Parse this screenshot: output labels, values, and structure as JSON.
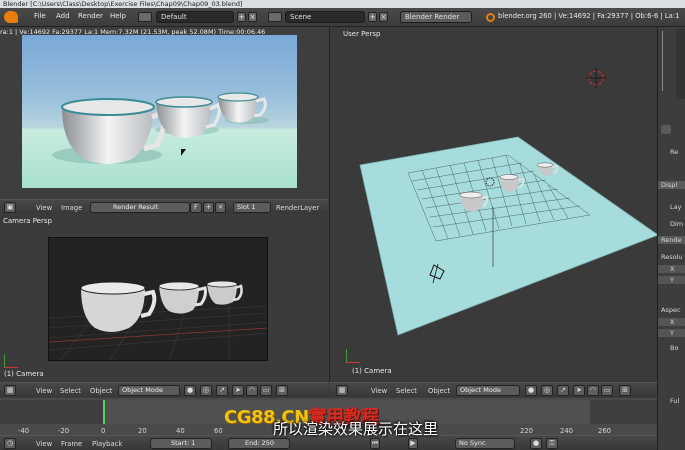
{
  "window": {
    "title": "Blender  [C:\\Users\\Class\\Desktop\\Exercise Files\\Chap09\\Chap09_03.blend]"
  },
  "info_header": {
    "menus": [
      "File",
      "Add",
      "Render",
      "Help"
    ],
    "screen_layout": "Default",
    "scene": "Scene",
    "engine": "Blender Render",
    "stats": "blender.org 260 | Ve:14692 | Fa:29377 | Ob:6-6 | La:1"
  },
  "image_editor": {
    "render_stats": "ra:1 | Ve:14692 Fa:29377 La:1 Mem:7.32M (21.53M, peak 52.08M) Time:00:06.46",
    "menus": [
      "View",
      "Image"
    ],
    "image_name": "Render Result",
    "fake_user": "F",
    "slot": "Slot 1",
    "layer": "RenderLayer"
  },
  "camera_view": {
    "label": "Camera Persp",
    "object": "(1) Camera"
  },
  "user_view": {
    "label": "User Persp",
    "object": "(1) Camera"
  },
  "view3d_header": {
    "menus": [
      "View",
      "Select",
      "Object"
    ],
    "mode": "Object Mode"
  },
  "timeline": {
    "ticks": [
      "-40",
      "-20",
      "0",
      "20",
      "40",
      "60",
      "80",
      "100",
      "120",
      "140",
      "160",
      "180",
      "200",
      "220",
      "240",
      "260"
    ],
    "menus": [
      "View",
      "Frame",
      "Playback"
    ],
    "start": "Start: 1",
    "end": "End: 250",
    "sync": "No Sync"
  },
  "properties": {
    "items": [
      "Re",
      "Displ",
      "Lay",
      "Dim",
      "Rende",
      "Resolu",
      "X",
      "Y",
      "Aspec",
      "X",
      "Y",
      "Bo",
      "Ful"
    ]
  },
  "overlay": {
    "watermark_a": "CG88.CN",
    "watermark_b": "實用教程",
    "subtitle": "所以渲染效果展示在这里"
  },
  "colors": {
    "accent": "#5680c2",
    "floor": "#a6dcdc",
    "render_bg": "#87b3d8"
  }
}
